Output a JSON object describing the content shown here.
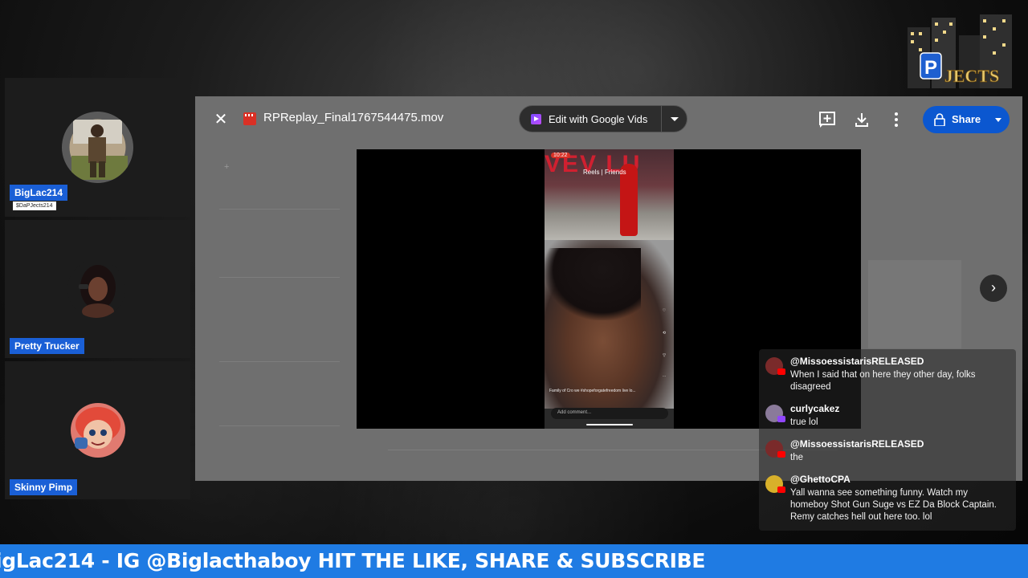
{
  "guests": [
    {
      "name": "BigLac214",
      "handle": "$DaPJects214"
    },
    {
      "name": "Pretty Trucker"
    },
    {
      "name": "Skinny Pimp"
    }
  ],
  "drive": {
    "filename": "RPReplay_Final1767544475.mov",
    "edit_button_label": "Edit with Google Vids",
    "share_label": "Share"
  },
  "chat": [
    {
      "user": "@MissoessistarisRELEASED",
      "text": "When I said that on here they other day, folks disagreed",
      "platform": "youtube"
    },
    {
      "user": "curlycakez",
      "text": "true lol",
      "platform": "twitch"
    },
    {
      "user": "@MissoessistarisRELEASED",
      "text": "the",
      "platform": "youtube"
    },
    {
      "user": "@GhettoCPA",
      "text": "Yall wanna see something funny. Watch my homeboy Shot Gun Suge vs EZ Da Block Captain. Remy catches hell out here too. lol",
      "platform": "youtube"
    }
  ],
  "ticker": {
    "text": "igLac214 - IG @Biglacthaboy HIT THE LIKE, SHARE & SUBSCRIBE"
  },
  "colors": {
    "name_tag": "#1a5fd6",
    "ticker_bg": "#1f7be3",
    "share_button": "#0b57d0"
  }
}
